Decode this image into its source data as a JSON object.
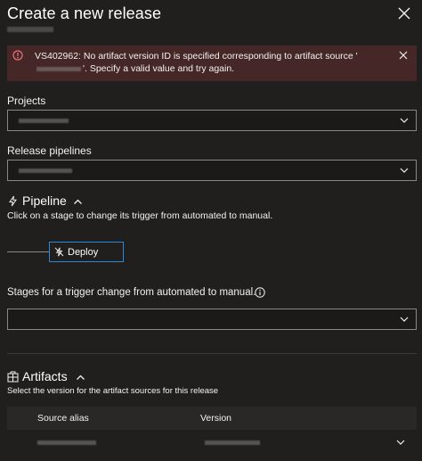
{
  "dialog": {
    "title": "Create a new release",
    "close_icon": "close-icon"
  },
  "error": {
    "message_prefix": "VS402962: No artifact version ID is specified corresponding to artifact source '",
    "message_suffix": "'. Specify a valid value and try again.",
    "icon": "error-circle-icon",
    "close_icon": "close-icon",
    "color": "#f1707b",
    "background": "#442726"
  },
  "projects": {
    "label": "Projects"
  },
  "release_pipelines": {
    "label": "Release pipelines"
  },
  "pipeline": {
    "title": "Pipeline",
    "hint": "Click on a stage to change its trigger from automated to manual.",
    "stage_label": "Deploy",
    "stage_icon": "lightning-icon",
    "accent": "#2b88d8"
  },
  "stages_trigger": {
    "label": "Stages for a trigger change from automated to manual.",
    "info_icon": "info-icon",
    "value": ""
  },
  "artifacts": {
    "title": "Artifacts",
    "icon": "artifact-icon",
    "hint": "Select the version for the artifact sources for this release",
    "columns": [
      "Source alias",
      "Version"
    ]
  }
}
